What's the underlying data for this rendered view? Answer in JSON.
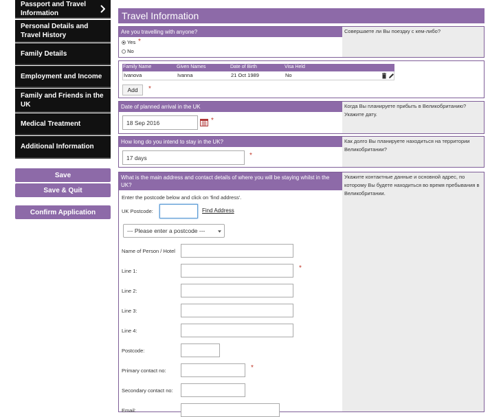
{
  "sidebar": {
    "items": [
      {
        "label": "Passport and Travel Information"
      },
      {
        "label": "Personal Details and Travel History"
      },
      {
        "label": "Family Details"
      },
      {
        "label": "Employment and Income"
      },
      {
        "label": "Family and Friends in the UK"
      },
      {
        "label": "Medical Treatment"
      },
      {
        "label": "Additional Information"
      }
    ],
    "save_label": "Save",
    "save_quit_label": "Save & Quit",
    "confirm_label": "Confirm Application"
  },
  "page": {
    "title": "Travel Information"
  },
  "companions": {
    "question": "Are you travelling with anyone?",
    "help": "Совершаете ли Вы поездку с кем-либо?",
    "yes_label": "Yes",
    "no_label": "No",
    "required": "*"
  },
  "people_table": {
    "headers": [
      "Family Name",
      "Given Names",
      "Date of Birth",
      "Visa Held"
    ],
    "rows": [
      [
        "Ivanova",
        "Ivanna",
        "21 Oct 1989",
        "No"
      ]
    ],
    "add_label": "Add"
  },
  "arrival": {
    "question": "Date of planned arrival in the UK",
    "help": "Когда Вы планируете прибыть в Великобританию? Укажите дату.",
    "value": "18 Sep 2016"
  },
  "stay": {
    "question": "How long do you intend to stay in the UK?",
    "help": "Как долго Вы планируете находиться на территории Великобритании?",
    "value": "17 days"
  },
  "address": {
    "question": "What is the main address and contact details of where you will be staying whilst in the UK?",
    "help": "Укажите контактные данные и основной адрес, по которому Вы будете находиться во время пребывания в Великобритании.",
    "instruction": "Enter the postcode below and click on 'find address'.",
    "postcode_label": "UK Postcode:",
    "find_label": "Find Address",
    "select_value": "--- Please enter a postcode ---",
    "name_label": "Name of Person / Hotel",
    "line1_label": "Line 1:",
    "line2_label": "Line 2:",
    "line3_label": "Line 3:",
    "line4_label": "Line 4:",
    "postcode2_label": "Postcode:",
    "primary_label": "Primary contact no:",
    "secondary_label": "Secondary contact no:",
    "email_label": "Email:"
  },
  "colors": {
    "accent": "#8d6aa8",
    "sidebar_bg": "#111111",
    "required": "#c0392b"
  }
}
